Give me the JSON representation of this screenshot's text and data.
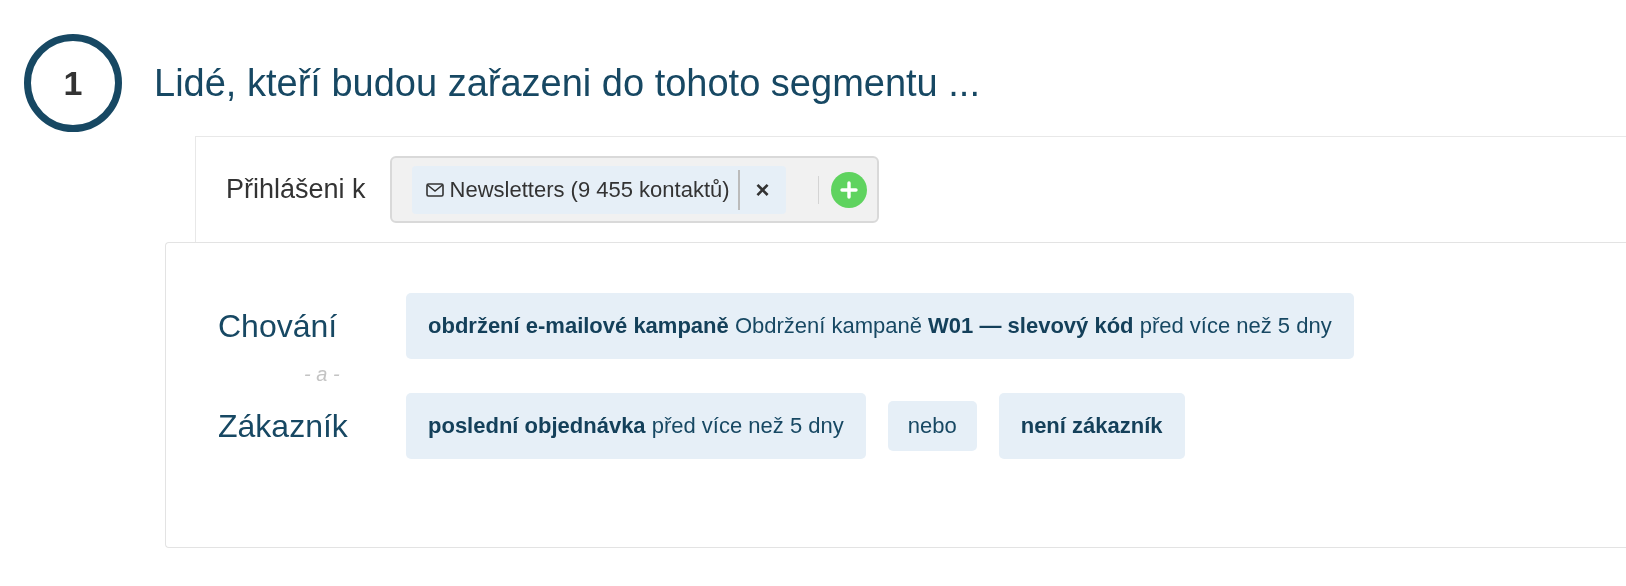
{
  "step": {
    "number": "1",
    "title": "Lidé, kteří budou zařazeni do tohoto segmentu ..."
  },
  "subscription": {
    "label": "Přihlášeni k",
    "tags": [
      {
        "text": "Newsletters (9 455 kontaktů)",
        "remove": "×"
      }
    ]
  },
  "conditions": [
    {
      "label": "Chování",
      "items": [
        {
          "kind": "chip",
          "text": "**obdržení e-mailové kampaně** Obdržení kampaně **W01 — slevový kód** před více než 5 dny"
        }
      ]
    },
    {
      "joiner": "- a -",
      "label": "Zákazník",
      "items": [
        {
          "kind": "chip",
          "text": "**poslední objednávka** před více než 5 dny"
        },
        {
          "kind": "or",
          "text": "nebo"
        },
        {
          "kind": "chip",
          "text": "**není zákazník**"
        }
      ]
    }
  ]
}
